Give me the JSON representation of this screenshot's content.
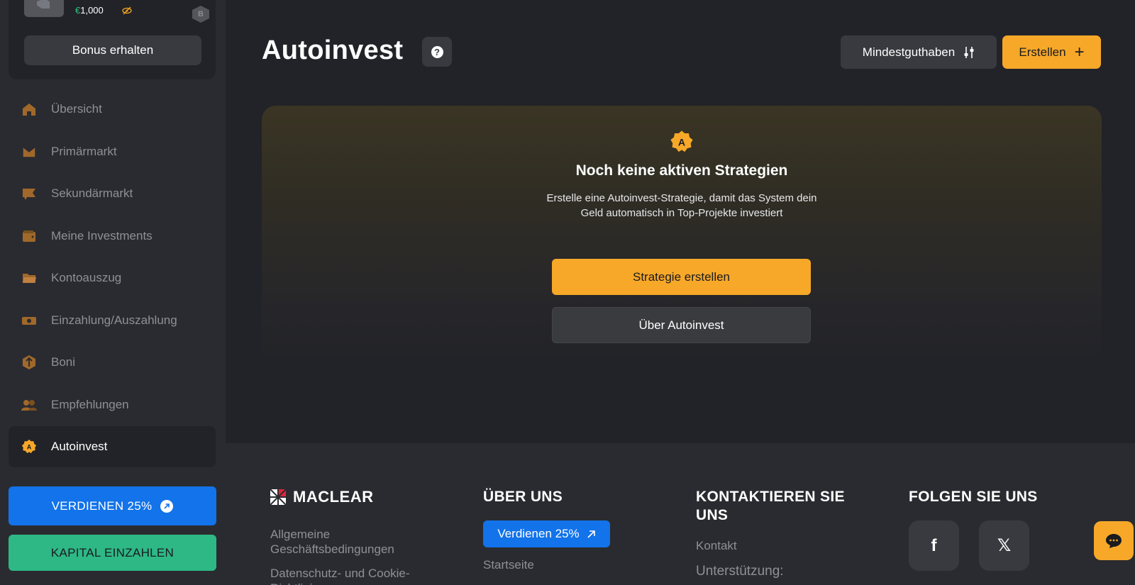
{
  "profile": {
    "currency": "€",
    "balance": "1,000",
    "level": "B",
    "bonus_button": "Bonus erhalten"
  },
  "sidebar": {
    "items": [
      {
        "label": "Übersicht",
        "icon": "home-icon"
      },
      {
        "label": "Primärmarkt",
        "icon": "inbox-icon"
      },
      {
        "label": "Sekundärmarkt",
        "icon": "flag-icon"
      },
      {
        "label": "Meine Investments",
        "icon": "wallet-icon"
      },
      {
        "label": "Kontoauszug",
        "icon": "folder-icon"
      },
      {
        "label": "Einzahlung/Auszahlung",
        "icon": "cash-icon"
      },
      {
        "label": "Boni",
        "icon": "bonus-icon"
      },
      {
        "label": "Empfehlungen",
        "icon": "users-icon"
      },
      {
        "label": "Autoinvest",
        "icon": "autoinvest-icon",
        "active": true
      }
    ],
    "earn_button": "VERDIENEN 25%",
    "deposit_button": "KAPITAL EINZAHLEN"
  },
  "header": {
    "title": "Autoinvest",
    "help_symbol": "?",
    "min_balance_button": "Mindestguthaben",
    "create_button": "Erstellen",
    "create_symbol": "+"
  },
  "empty_state": {
    "icon_letter": "A",
    "title": "Noch keine aktiven Strategien",
    "description": "Erstelle eine Autoinvest-Strategie, damit das System dein Geld automatisch in Top-Projekte investiert",
    "primary_button": "Strategie erstellen",
    "secondary_button": "Über Autoinvest"
  },
  "footer": {
    "logo_text": "MACLEAR",
    "col1": {
      "links": [
        "Allgemeine Geschäftsbedingungen",
        "Datenschutz- und Cookie-Richtlinien"
      ]
    },
    "col2": {
      "title": "ÜBER UNS",
      "earn_chip": "Verdienen 25%",
      "links": [
        "Startseite"
      ]
    },
    "col3": {
      "title": "KONTAKTIEREN SIE UNS",
      "links": [
        "Kontakt",
        "Unterstützung:"
      ]
    },
    "col4": {
      "title": "FOLGEN SIE UNS",
      "social": [
        "f",
        "𝕏"
      ]
    }
  },
  "colors": {
    "accent": "#f7a829",
    "blue": "#1273ea",
    "green": "#2eb886",
    "background": "#222328",
    "sidebar": "#2a2b30"
  }
}
